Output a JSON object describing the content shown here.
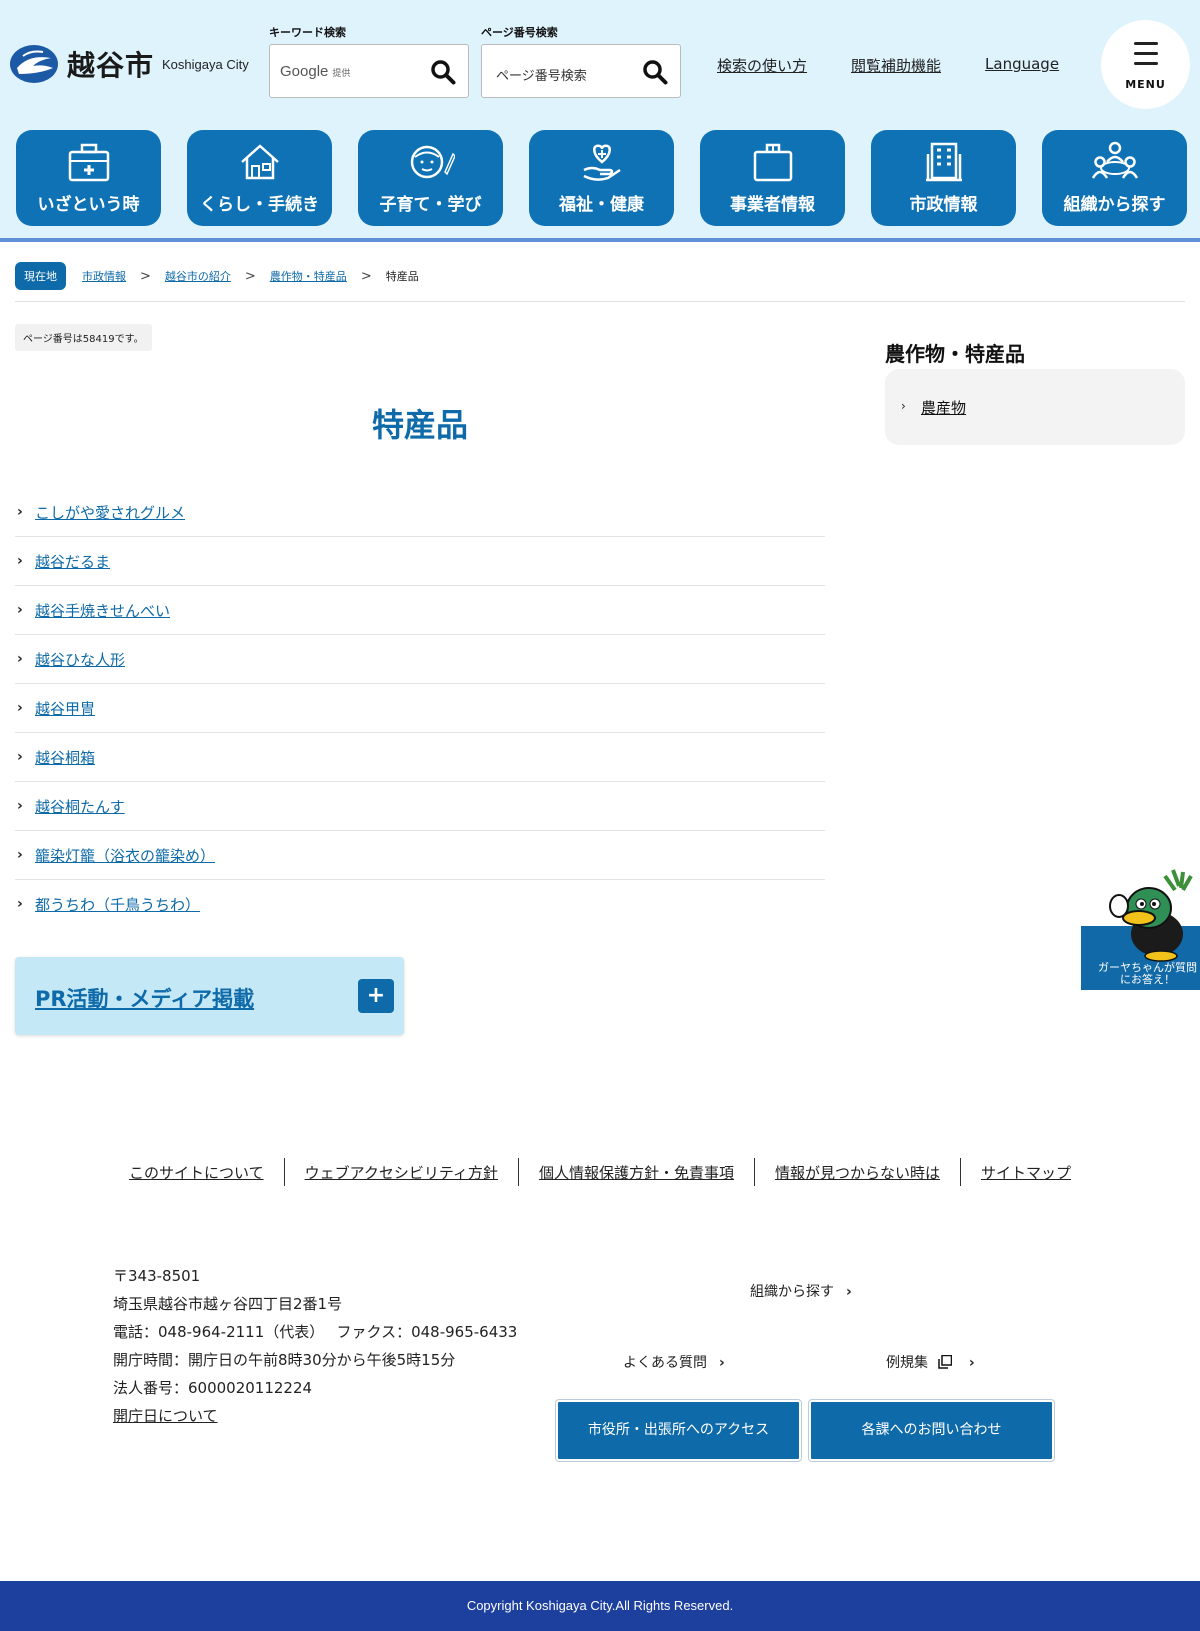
{
  "header": {
    "logo_ja": "越谷市",
    "logo_en": "Koshigaya City",
    "keyword_search_label": "キーワード検索",
    "keyword_search_google": "Google",
    "keyword_search_google_sub": "提供",
    "page_search_label": "ページ番号検索",
    "page_search_placeholder": "ページ番号検索",
    "util_links": [
      "検索の使い方",
      "閲覧補助機能",
      "Language"
    ],
    "menu_label": "MENU"
  },
  "nav": [
    {
      "label": "いざという時",
      "icon": "first-aid-kit-icon"
    },
    {
      "label": "くらし・手続き",
      "icon": "house-icon"
    },
    {
      "label": "子育て・学び",
      "icon": "child-pencil-icon"
    },
    {
      "label": "福祉・健康",
      "icon": "heart-hand-icon"
    },
    {
      "label": "事業者情報",
      "icon": "briefcase-icon"
    },
    {
      "label": "市政情報",
      "icon": "building-icon"
    },
    {
      "label": "組織から探す",
      "icon": "people-group-icon"
    }
  ],
  "breadcrumb": {
    "here": "現在地",
    "items": [
      "市政情報",
      "越谷市の紹介",
      "農作物・特産品"
    ],
    "separator": ">",
    "current": "特産品"
  },
  "main": {
    "page_number": "ページ番号は58419です。",
    "title": "特産品",
    "links": [
      "こしがや愛されグルメ",
      "越谷だるま",
      "越谷手焼きせんべい",
      "越谷ひな人形",
      "越谷甲冑",
      "越谷桐箱",
      "越谷桐たんす",
      "籠染灯籠（浴衣の籠染め）",
      "都うちわ（千鳥うちわ）"
    ],
    "pr_label": "PR活動・メディア掲載",
    "pr_button": "+"
  },
  "sidebar": {
    "title": "農作物・特産品",
    "items": [
      "農産物"
    ]
  },
  "mascot": {
    "text": "ガーヤちゃんが質問にお答え！"
  },
  "footer": {
    "links": [
      "このサイトについて",
      "ウェブアクセシビリティ方針",
      "個人情報保護方針・免責事項",
      "情報が見つからない時は",
      "サイトマップ"
    ],
    "postal": "〒343-8501",
    "address": "埼玉県越谷市越ヶ谷四丁目2番1号",
    "phone": "電話：048-964-2111（代表）　 ファクス：048-965-6433",
    "hours": "開庁時間：開庁日の午前8時30分から午後5時15分",
    "corp_number": "法人番号：6000020112224",
    "open_days_link": "開庁日について",
    "nav_org": "組織から探す",
    "nav_faq": "よくある質問",
    "nav_rules": "例規集",
    "btn_access": "市役所・出張所へのアクセス",
    "btn_contact": "各課へのお問い合わせ",
    "copyright": "Copyright Koshigaya City.All Rights Reserved."
  },
  "colors": {
    "header_bg": "#dff3fd",
    "brand_blue": "#0e72b5",
    "link_blue": "#0e6aa8",
    "footer_bar": "#1d3f9e"
  }
}
